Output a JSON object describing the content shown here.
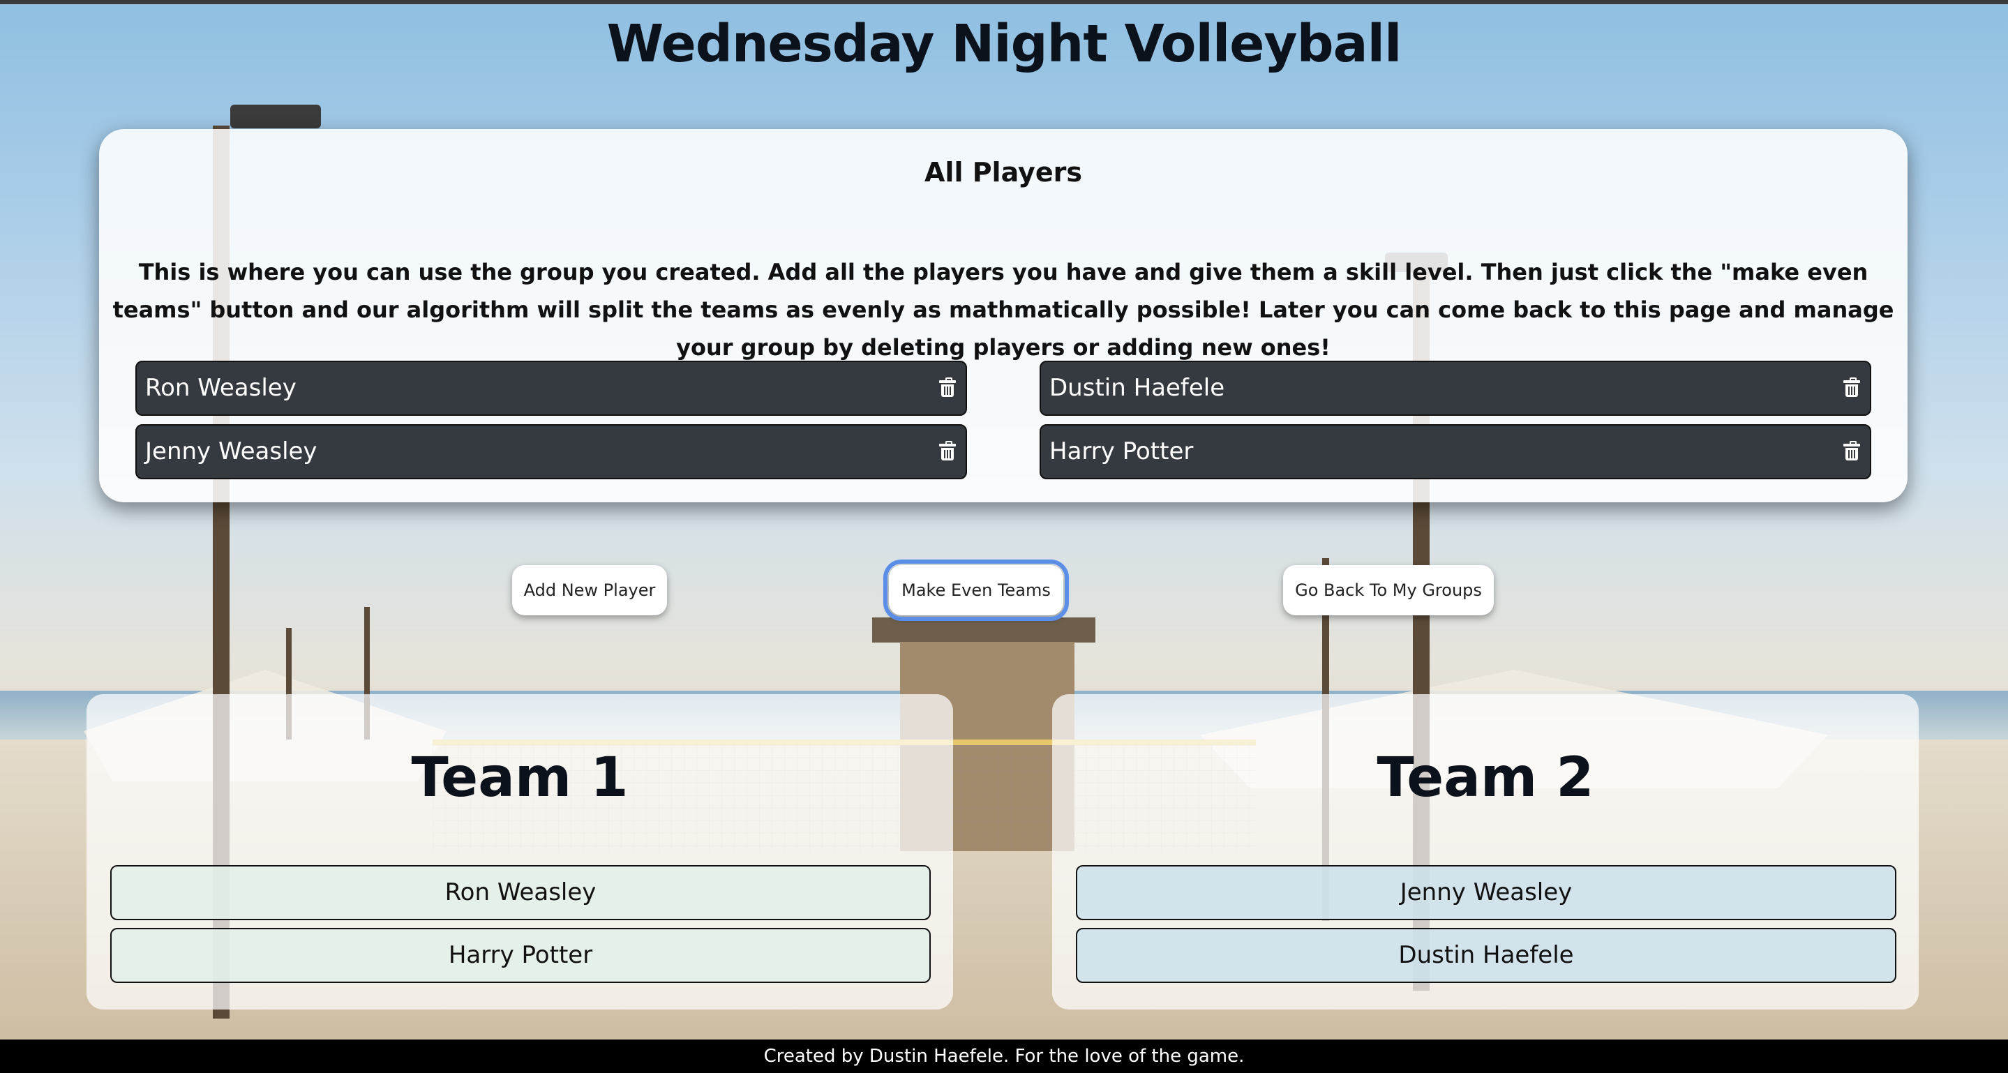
{
  "page": {
    "title": "Wednesday Night Volleyball"
  },
  "players_card": {
    "heading": "All Players",
    "intro": "This is where you can use the group you created. Add all the players you have and give them a skill level. Then just click the \"make even teams\" button and our algorithm will split the teams as evenly as mathmatically possible! Later you can come back to this page and manage your group by deleting players or adding new ones!",
    "players": [
      {
        "name": "Ron Weasley",
        "icon": "trash-icon"
      },
      {
        "name": "Dustin Haefele",
        "icon": "trash-icon"
      },
      {
        "name": "Jenny Weasley",
        "icon": "trash-icon"
      },
      {
        "name": "Harry Potter",
        "icon": "trash-icon"
      }
    ]
  },
  "actions": {
    "add_player": "Add New Player",
    "make_teams": "Make Even Teams",
    "go_back": "Go Back To My Groups"
  },
  "teams": [
    {
      "title": "Team 1",
      "members": [
        "Ron Weasley",
        "Harry Potter"
      ]
    },
    {
      "title": "Team 2",
      "members": [
        "Jenny Weasley",
        "Dustin Haefele"
      ]
    }
  ],
  "footer": {
    "text": "Created by Dustin Haefele. For the love of the game."
  },
  "colors": {
    "player_row_bg": "#343a40",
    "focus_outline": "#5b8ee6",
    "footer_bg": "#000000"
  }
}
